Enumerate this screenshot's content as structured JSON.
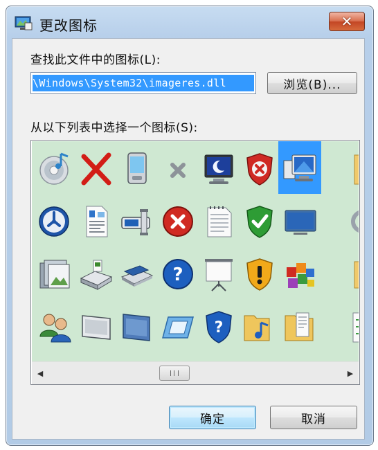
{
  "window": {
    "title": "更改图标",
    "close_label": "✕"
  },
  "file_label": "查找此文件中的图标(L):",
  "path": {
    "value": "\\Windows\\System32\\imageres.dll"
  },
  "browse_label": "浏览(B)...",
  "list_label": "从以下列表中选择一个图标(S):",
  "icons": [
    [
      "cd-music-icon",
      "red-x-icon",
      "pda-device-icon",
      "gray-x-icon",
      "monitor-night-icon",
      "shield-error-icon",
      "monitor-selected-icon",
      "folder-partial-icon"
    ],
    [
      "blue-disc-icon",
      "document-rich-icon",
      "card-reader-icon",
      "error-circle-icon",
      "notepad-icon",
      "shield-check-icon",
      "flat-monitor-icon",
      "gear-partial-icon"
    ],
    [
      "photo-library-icon",
      "scanner-icon",
      "flatbed-icon",
      "help-circle-icon",
      "projector-screen-icon",
      "shield-warning-icon",
      "colorful-blocks-icon",
      "folder-partial-icon"
    ],
    [
      "users-icon",
      "card-icon",
      "blue-panel-icon",
      "blue-tile-icon",
      "shield-help-icon",
      "music-folder-icon",
      "document-folder-icon",
      "arrows-partial-icon"
    ]
  ],
  "selected_icon": "monitor-selected-icon",
  "ok_label": "确定",
  "cancel_label": "取消",
  "colors": {
    "selection": "#3399ff",
    "list_background": "#cfe8d2",
    "title_bar": "#b9d1ea"
  }
}
